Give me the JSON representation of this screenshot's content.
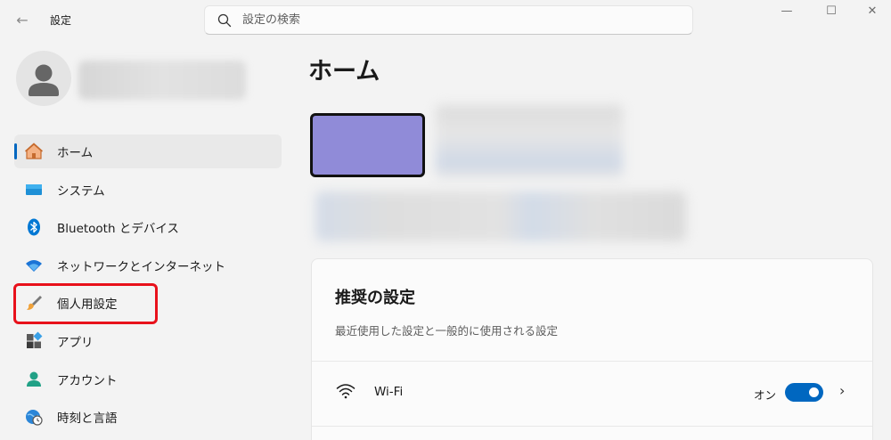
{
  "window": {
    "title": "設定",
    "back_icon": "←",
    "controls": {
      "minimize": "—",
      "maximize": "☐",
      "close": "✕"
    }
  },
  "search": {
    "placeholder": "設定の検索",
    "value": ""
  },
  "sidebar": {
    "items": [
      {
        "label": "ホーム",
        "icon": "home-icon",
        "active": true
      },
      {
        "label": "システム",
        "icon": "system-icon"
      },
      {
        "label": "Bluetooth とデバイス",
        "icon": "bluetooth-icon"
      },
      {
        "label": "ネットワークとインターネット",
        "icon": "network-icon"
      },
      {
        "label": "個人用設定",
        "icon": "personalization-icon",
        "highlighted": true
      },
      {
        "label": "アプリ",
        "icon": "apps-icon"
      },
      {
        "label": "アカウント",
        "icon": "account-icon"
      },
      {
        "label": "時刻と言語",
        "icon": "time-language-icon"
      }
    ]
  },
  "main": {
    "title": "ホーム",
    "recommended": {
      "title": "推奨の設定",
      "subtitle": "最近使用した設定と一般的に使用される設定",
      "wifi": {
        "label": "Wi-Fi",
        "state": "オン",
        "on": true
      }
    }
  },
  "colors": {
    "accent": "#0067c0",
    "highlight_border": "#e8111b",
    "device_image": "#908bd8"
  }
}
